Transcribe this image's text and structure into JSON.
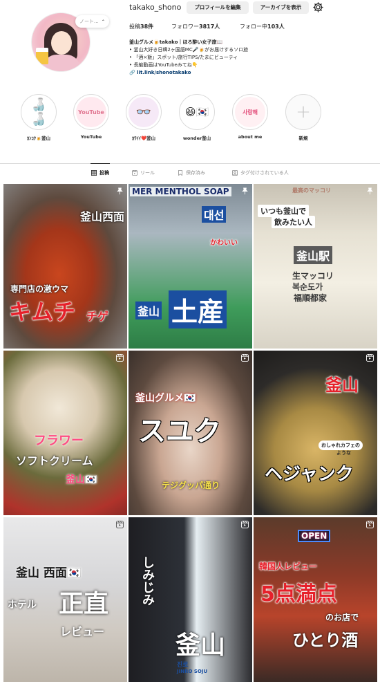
{
  "profile": {
    "username": "takako_shono",
    "edit_button": "プロフィールを編集",
    "archive_button": "アーカイブを表示",
    "note": "ノート...",
    "stats": {
      "posts_label": "投稿",
      "posts_value": "38件",
      "followers_label": "フォロワー",
      "followers_value": "3817人",
      "following_label": "フォロー中",
      "following_value": "103人"
    },
    "bio": {
      "name": "釜山グルメ🍺takako｜ほろ酔い女子旅📖",
      "line1": "‣ 釜山大好き日韓2ヶ国語MC🎤🍺がお届けするソロ旅",
      "line2": "‣ 「酒×飯」スポット/旅行TIPS/たまにビューティ",
      "line3": "‣ 長編動画はYouTubeみてね👇",
      "link": "lit.link/shonotakako"
    }
  },
  "highlights": [
    {
      "label": "ｶﾝｺｸ🍺釜山",
      "inner": "🍶🍶",
      "bg": "#ffffff"
    },
    {
      "label": "YouTube",
      "inner": "YouTube",
      "bg": "#ffe9ef"
    },
    {
      "label": "ｶﾜｲｲ❤️釜山",
      "inner": "👓",
      "bg": "#f6e9f7"
    },
    {
      "label": "wonder釜山",
      "inner": "😆🇰🇷",
      "bg": "#ffffff"
    },
    {
      "label": "about me",
      "inner": "사랑해",
      "bg": "#fff0f3"
    },
    {
      "label": "新規",
      "inner": "+",
      "bg": "#fafafa"
    }
  ],
  "tabs": [
    {
      "label": "投稿",
      "active": true
    },
    {
      "label": "リール",
      "active": false
    },
    {
      "label": "保存済み",
      "active": false
    },
    {
      "label": "タグ付けされている人",
      "active": false
    }
  ],
  "posts": [
    {
      "bg": "kimchi",
      "texts": [
        "釜山西面",
        "専門店の激ウマ",
        "キムチ",
        "チゲ"
      ],
      "badge": "pin"
    },
    {
      "bg": "soju",
      "texts": [
        "MER MENTHOL SOAP",
        "대선",
        "かわいい",
        "釜山",
        "土産"
      ],
      "badge": "pin"
    },
    {
      "bg": "makgeolli",
      "texts": [
        "最高のマッコリ",
        "いつも釜山で",
        "飲みたい人",
        "釜山駅",
        "生マッコリ",
        "복순도가",
        "福順都家"
      ],
      "badge": "pin"
    },
    {
      "bg": "icecream",
      "texts": [
        "フラワー",
        "ソフトクリーム",
        "釜山🇰🇷"
      ],
      "badge": "reel"
    },
    {
      "bg": "suyuk",
      "texts": [
        "釜山グルメ🇰🇷",
        "スユク",
        "テジグッパ通り"
      ],
      "badge": "reel"
    },
    {
      "bg": "soup",
      "texts": [
        "釜山",
        "おしゃれカフェの",
        "ような",
        "ヘジャンク"
      ],
      "badge": "reel"
    },
    {
      "bg": "hotel",
      "texts": [
        "釜山 西面🇰🇷",
        "ホテル",
        "正直",
        "レビュー"
      ],
      "badge": "reel"
    },
    {
      "bg": "bottle",
      "texts": [
        "しみじみ",
        "釜山",
        "진로",
        "JINRO SOJU"
      ],
      "badge": "reel"
    },
    {
      "bg": "street",
      "texts": [
        "OPEN",
        "韓国人レビュー",
        "5点満点",
        "のお店で",
        "ひとり酒"
      ],
      "badge": "reel"
    }
  ],
  "colors": {
    "text": "#262626",
    "muted": "#8e8e8e",
    "button_bg": "#efefef",
    "link": "#00376b",
    "divider": "#dbdbdb",
    "accent_red": "#e6202a"
  }
}
